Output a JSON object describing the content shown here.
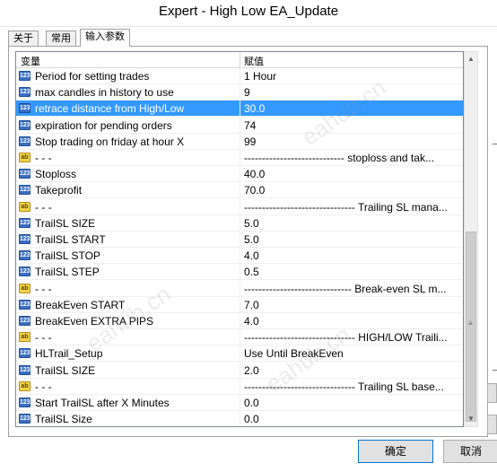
{
  "window": {
    "title": "Expert - High Low EA_Update"
  },
  "tabs": [
    {
      "label": "关于",
      "active": false
    },
    {
      "label": "常用",
      "active": false
    },
    {
      "label": "输入参数",
      "active": true
    }
  ],
  "table": {
    "columns": [
      "变量",
      "赋值"
    ],
    "rows": [
      {
        "icon": "num-icon",
        "type": "123",
        "name": "Period for setting trades",
        "value": "1 Hour",
        "selected": false
      },
      {
        "icon": "num-icon",
        "type": "123",
        "name": "max candles in history to use",
        "value": "9",
        "selected": false
      },
      {
        "icon": "num-icon",
        "type": "123",
        "name": "retrace distance from High/Low",
        "value": "30.0",
        "selected": true
      },
      {
        "icon": "num-icon",
        "type": "123",
        "name": "expiration for pending orders",
        "value": "74",
        "selected": false
      },
      {
        "icon": "num-icon",
        "type": "123",
        "name": "Stop trading on friday at hour X",
        "value": "99",
        "selected": false
      },
      {
        "icon": "text-icon",
        "type": "ab",
        "name": "- - -",
        "value": "---------------------------- stoploss and tak...",
        "selected": false
      },
      {
        "icon": "num-icon",
        "type": "123",
        "name": "Stoploss",
        "value": "40.0",
        "selected": false
      },
      {
        "icon": "num-icon",
        "type": "123",
        "name": "Takeprofit",
        "value": "70.0",
        "selected": false
      },
      {
        "icon": "text-icon",
        "type": "ab",
        "name": "- - -",
        "value": "------------------------------- Trailing SL mana...",
        "selected": false
      },
      {
        "icon": "num-icon",
        "type": "123",
        "name": "TrailSL SIZE",
        "value": "5.0",
        "selected": false
      },
      {
        "icon": "num-icon",
        "type": "123",
        "name": "TrailSL START",
        "value": "5.0",
        "selected": false
      },
      {
        "icon": "num-icon",
        "type": "123",
        "name": "TrailSL STOP",
        "value": "4.0",
        "selected": false
      },
      {
        "icon": "num-icon",
        "type": "123",
        "name": "TrailSL STEP",
        "value": "0.5",
        "selected": false
      },
      {
        "icon": "text-icon",
        "type": "ab",
        "name": "- - -",
        "value": "------------------------------ Break-even SL m...",
        "selected": false
      },
      {
        "icon": "num-icon",
        "type": "123",
        "name": "BreakEven START",
        "value": "7.0",
        "selected": false
      },
      {
        "icon": "num-icon",
        "type": "123",
        "name": "BreakEven EXTRA PIPS",
        "value": "4.0",
        "selected": false
      },
      {
        "icon": "text-icon",
        "type": "ab",
        "name": "- - -",
        "value": "------------------------------- HIGH/LOW Traili...",
        "selected": false
      },
      {
        "icon": "num-icon",
        "type": "123",
        "name": "HLTrail_Setup",
        "value": "Use Until BreakEven",
        "selected": false
      },
      {
        "icon": "num-icon",
        "type": "123",
        "name": "TrailSL SIZE",
        "value": "2.0",
        "selected": false
      },
      {
        "icon": "text-icon",
        "type": "ab",
        "name": "- - -",
        "value": "------------------------------- Trailing SL base...",
        "selected": false
      },
      {
        "icon": "num-icon",
        "type": "123",
        "name": "Start TrailSL after X Minutes",
        "value": "0.0",
        "selected": false
      },
      {
        "icon": "num-icon",
        "type": "123",
        "name": "TrailSL Size",
        "value": "0.0",
        "selected": false
      }
    ]
  },
  "buttons": {
    "ok": "确定",
    "cancel": "取消"
  },
  "watermark": "eahub.cn",
  "colors": {
    "selection": "#3399ff",
    "accent": "#0078d7"
  }
}
